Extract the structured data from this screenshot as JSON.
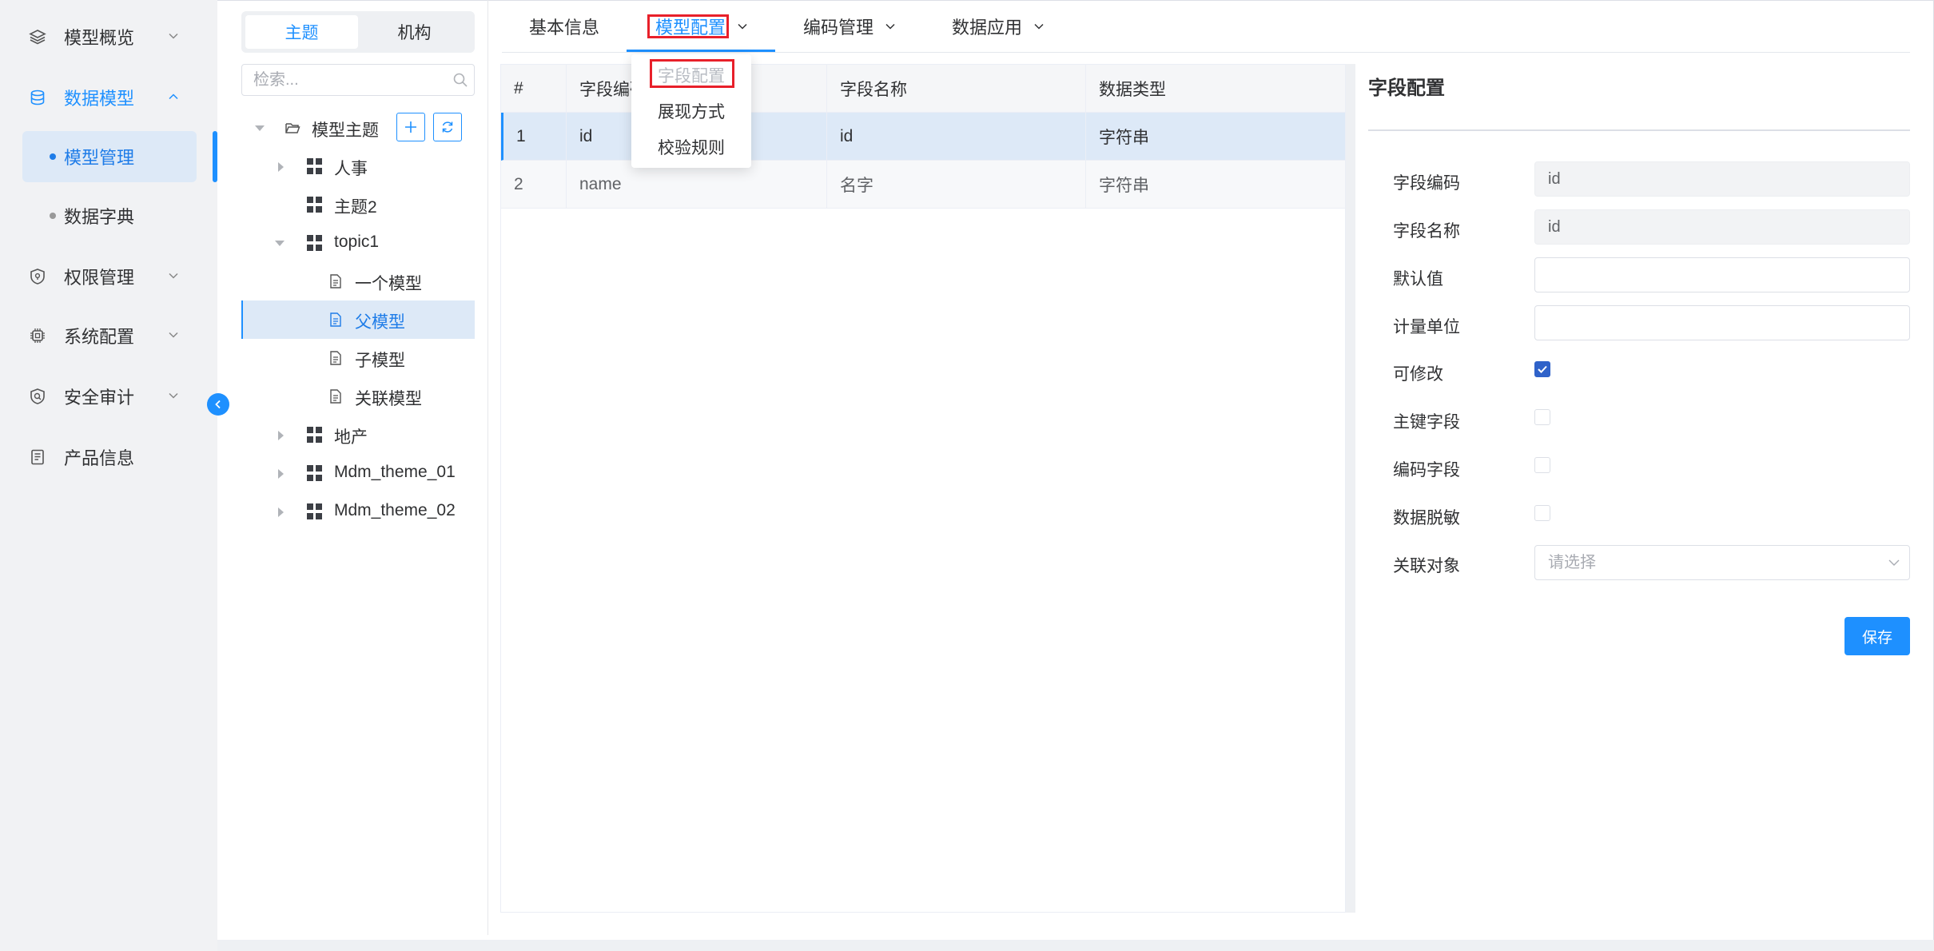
{
  "nav": {
    "items": [
      {
        "label": "模型概览",
        "icon": "layers-icon"
      },
      {
        "label": "数据模型",
        "icon": "database-icon"
      },
      {
        "label": "权限管理",
        "icon": "shield-icon"
      },
      {
        "label": "系统配置",
        "icon": "chip-icon"
      },
      {
        "label": "安全审计",
        "icon": "audit-shield-icon"
      },
      {
        "label": "产品信息",
        "icon": "document-icon"
      }
    ],
    "sub_items": [
      {
        "label": "模型管理"
      },
      {
        "label": "数据字典"
      }
    ]
  },
  "tree": {
    "segments": [
      "主题",
      "机构"
    ],
    "search_placeholder": "检索...",
    "root": "模型主题",
    "nodes": [
      "人事",
      "主题2",
      "topic1",
      "一个模型",
      "父模型",
      "子模型",
      "关联模型",
      "地产",
      "Mdm_theme_01",
      "Mdm_theme_02"
    ]
  },
  "tabs": {
    "items": [
      "基本信息",
      "模型配置",
      "编码管理",
      "数据应用"
    ],
    "active": "模型配置"
  },
  "dropdown": {
    "items": [
      "字段配置",
      "展现方式",
      "校验规则"
    ]
  },
  "table": {
    "headers": [
      "#",
      "字段编码",
      "字段名称",
      "数据类型"
    ],
    "rows": [
      [
        "1",
        "id",
        "id",
        "字符串"
      ],
      [
        "2",
        "name",
        "名字",
        "字符串"
      ]
    ]
  },
  "config": {
    "title": "字段配置",
    "labels": [
      "字段编码",
      "字段名称",
      "默认值",
      "计量单位",
      "可修改",
      "主键字段",
      "编码字段",
      "数据脱敏",
      "关联对象"
    ],
    "field_code": "id",
    "field_name": "id",
    "default_value": "",
    "unit": "",
    "editable": true,
    "primary_key": false,
    "code_field": false,
    "masking": false,
    "related_placeholder": "请选择",
    "save_label": "保存"
  },
  "colors": {
    "accent": "#1e90ff",
    "selected_bg": "#dde9f7",
    "highlight_box": "#e8202a"
  }
}
